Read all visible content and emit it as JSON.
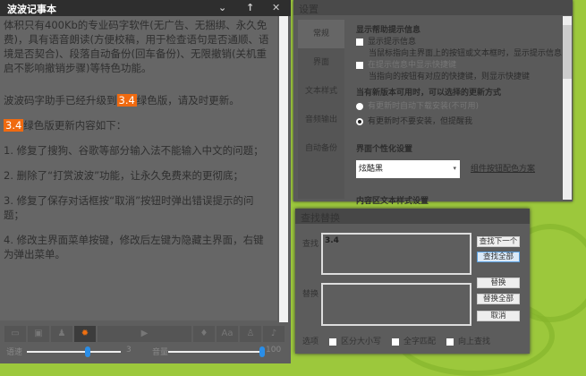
{
  "editor": {
    "title": "波波记事本",
    "controls": {
      "dropdown": "⌄",
      "pin": "↑",
      "close": "✕"
    },
    "intro": "体积只有400Kb的专业码字软件(无广告、无捆绑、永久免费)，具有语音朗读(方便校稿，用于检查语句是否通顺、语境是否契合)、段落自动备份(回车备份)、无限撤销(关机重启不影响撤销步骤)等特色功能。",
    "upgrade_pre": "波波码字助手已经升级到",
    "version": "3.4",
    "upgrade_post": "绿色版，请及时更新。",
    "changes_post": "绿色版更新内容如下：",
    "items": [
      "1. 修复了搜狗、谷歌等部分输入法不能输入中文的问题；",
      "2. 删除了“打赏波波”功能，让永久免费来的更彻底；",
      "3. 修复了保存对话框按“取消”按钮时弹出错误提示的问题；",
      "4. 修改主界面菜单按键，修改后左键为隐藏主界面，右键为弹出菜单。"
    ],
    "sliders": {
      "speed_label": "语速",
      "speed_value": "3",
      "speed_level": 0.65,
      "volume_label": "音量",
      "volume_value": "100",
      "volume_level": 1.0
    }
  },
  "settings": {
    "title": "设置",
    "tabs": [
      "常规",
      "界面",
      "文本样式",
      "音频输出",
      "自动备份"
    ],
    "help_heading": "显示帮助提示信息",
    "show_tips": "显示提示信息",
    "show_tips_desc": "当鼠标指向主界面上的按钮或文本框时，显示提示信息",
    "show_shortcuts": "在提示信息中显示快捷键",
    "show_shortcuts_desc": "当指向的按钮有对应的快捷键，则显示快捷键",
    "update_heading": "当有新版本可用时，可以选择的更新方式",
    "update_auto": "有更新时自动下载安装(不可用)",
    "update_notify": "有更新时不要安装，但提醒我",
    "ui_heading": "界面个性化设置",
    "theme": "炫酷黑",
    "theme_link": "组件按钮配色方案",
    "text_heading": "内容区文本样式设置"
  },
  "find": {
    "title": "查找替换",
    "find_label": "查找",
    "find_value": "3.4",
    "replace_label": "替换",
    "find_next": "查找下一个",
    "find_all": "查找全部",
    "replace": "替换",
    "replace_all": "替换全部",
    "cancel": "取消",
    "options_label": "选项",
    "match_case": "区分大小写",
    "whole_word": "全字匹配",
    "search_up": "向上查找"
  }
}
